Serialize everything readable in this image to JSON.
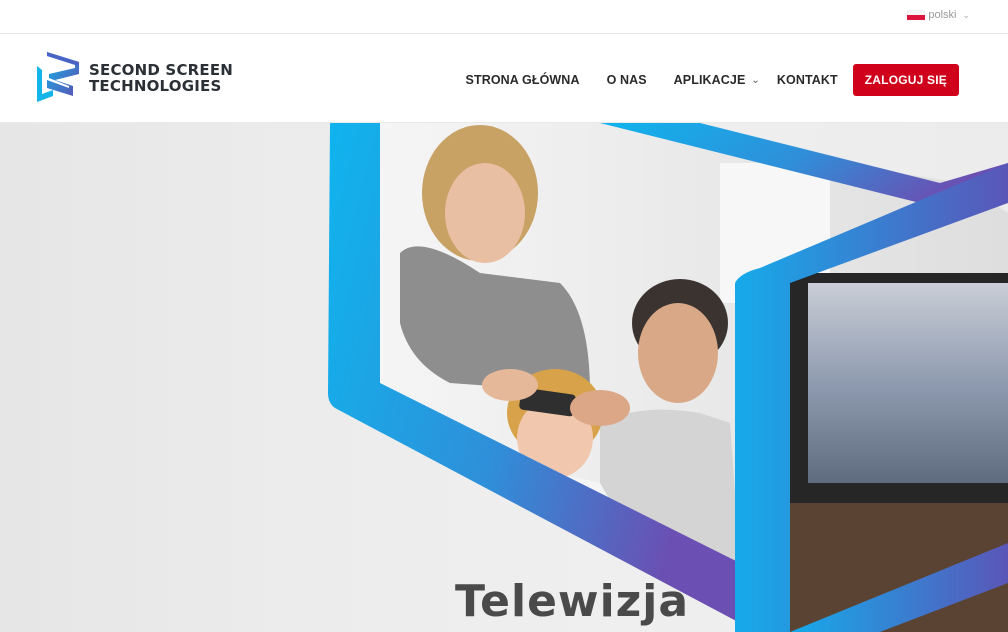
{
  "topbar": {
    "language_label": "polski",
    "language_icon": "poland-flag-icon"
  },
  "logo": {
    "line1": "SECOND SCREEN",
    "line2": "TECHNOLOGIES"
  },
  "nav": {
    "items": [
      {
        "label": "STRONA GŁÓWNA"
      },
      {
        "label": "O NAS"
      },
      {
        "label": "APLIKACJE",
        "has_dropdown": true
      },
      {
        "label": "KONTAKT"
      }
    ],
    "login_label": "ZALOGUJ SIĘ"
  },
  "hero": {
    "title": "Telewizja"
  },
  "colors": {
    "accent_red": "#d0021b",
    "brand_blue": "#1aa7e8",
    "brand_purple": "#6a4fb0",
    "text_dark": "#2a2a2a"
  }
}
